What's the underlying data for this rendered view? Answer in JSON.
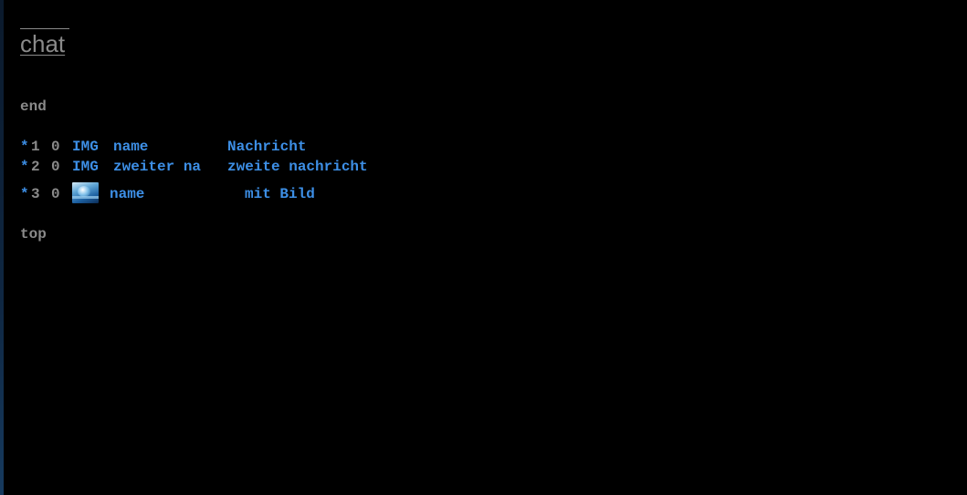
{
  "page": {
    "title": "chat",
    "end_link": "end",
    "top_link": "top"
  },
  "messages": [
    {
      "star": "*",
      "index": "1",
      "count": "0",
      "image": "IMG",
      "name": "name",
      "text": "Nachricht"
    },
    {
      "star": "*",
      "index": "2",
      "count": "0",
      "image": "IMG",
      "name": "zweiter na",
      "text": "zweite nachricht"
    },
    {
      "star": "*",
      "index": "3",
      "count": "0",
      "image_icon": "avatar-image",
      "name": "name",
      "text": "mit Bild"
    }
  ],
  "colors": {
    "background": "#000000",
    "muted": "#8a8a8a",
    "accent": "#3d8fe6"
  }
}
